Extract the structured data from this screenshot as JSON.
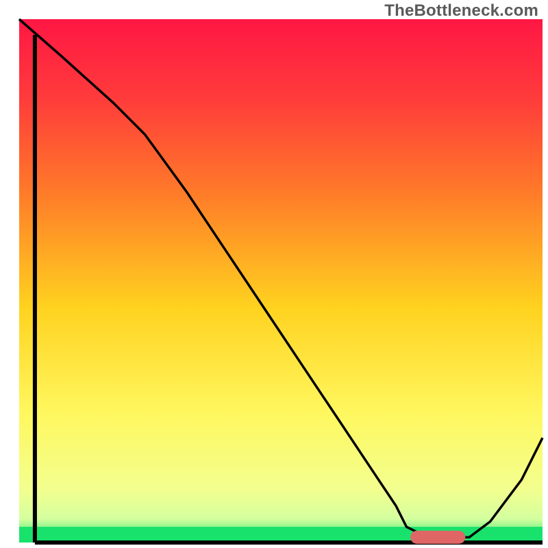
{
  "watermark": "TheBottleneck.com",
  "chart_data": {
    "type": "line",
    "title": "",
    "xlabel": "",
    "ylabel": "",
    "xlim": [
      0,
      100
    ],
    "ylim": [
      0,
      100
    ],
    "grid": false,
    "legend": false,
    "background_gradient": {
      "stops": [
        {
          "offset": 0.0,
          "color": "#ff1744"
        },
        {
          "offset": 0.15,
          "color": "#ff3b3b"
        },
        {
          "offset": 0.33,
          "color": "#ff7a29"
        },
        {
          "offset": 0.55,
          "color": "#ffd21f"
        },
        {
          "offset": 0.75,
          "color": "#fff75e"
        },
        {
          "offset": 0.9,
          "color": "#f2ff8f"
        },
        {
          "offset": 0.955,
          "color": "#d4ff9f"
        },
        {
          "offset": 1.0,
          "color": "#18e26b"
        }
      ]
    },
    "green_band": {
      "y_from": 97,
      "y_to": 100,
      "color": "#18e26b"
    },
    "series": [
      {
        "name": "bottleneck-curve",
        "color": "#000000",
        "x": [
          0,
          8,
          18,
          24,
          32,
          40,
          48,
          56,
          62,
          68,
          72,
          74,
          78,
          82,
          86,
          90,
          96,
          100
        ],
        "y": [
          0,
          7,
          16,
          22,
          33,
          45,
          57,
          69,
          78,
          87,
          93,
          97,
          99,
          99,
          99,
          96,
          88,
          80
        ]
      }
    ],
    "marker_bar": {
      "x_from": 76,
      "x_to": 84,
      "y": 99,
      "color": "#e06666",
      "thickness": 2.5
    },
    "axes": {
      "left": {
        "x": 3,
        "y_from": 3,
        "y_to": 100
      },
      "bottom": {
        "y": 100,
        "x_from": 3,
        "x_to": 100
      }
    }
  }
}
